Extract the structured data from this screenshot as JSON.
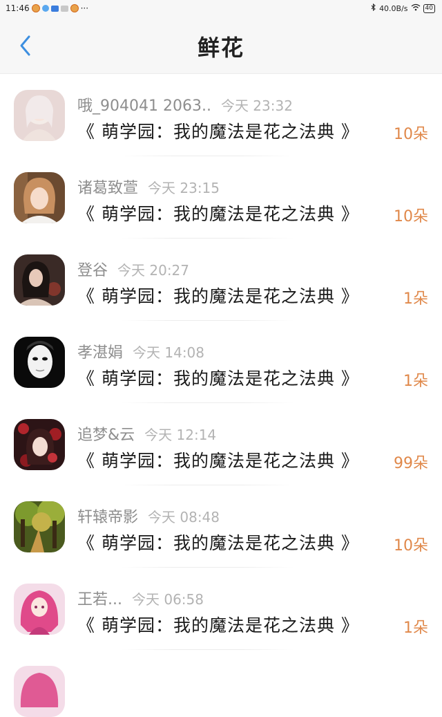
{
  "status_bar": {
    "time": "11:46",
    "more": "···",
    "speed": "40.0B/s",
    "battery": "40"
  },
  "header": {
    "title": "鲜花"
  },
  "gifts": [
    {
      "username": "哦_904041 2063..",
      "time": "今天 23:32",
      "book": "《 萌学园：我的魔法是花之法典 》",
      "amount": "10朵",
      "avatar": "avatar-girl-white-hair"
    },
    {
      "username": "诸葛致萱",
      "time": "今天 23:15",
      "book": "《 萌学园：我的魔法是花之法典 》",
      "amount": "10朵",
      "avatar": "avatar-girl-photo"
    },
    {
      "username": "登谷",
      "time": "今天 20:27",
      "book": "《 萌学园：我的魔法是花之法典 》",
      "amount": "1朵",
      "avatar": "avatar-girl-dark"
    },
    {
      "username": "孝湛娟",
      "time": "今天 14:08",
      "book": "《 萌学园：我的魔法是花之法典 》",
      "amount": "1朵",
      "avatar": "avatar-mask"
    },
    {
      "username": "追梦&云",
      "time": "今天 12:14",
      "book": "《 萌学园：我的魔法是花之法典 》",
      "amount": "99朵",
      "avatar": "avatar-anime-red"
    },
    {
      "username": "轩辕帝影",
      "time": "今天 08:48",
      "book": "《 萌学园：我的魔法是花之法典 》",
      "amount": "10朵",
      "avatar": "avatar-forest"
    },
    {
      "username": "王若...",
      "time": "今天 06:58",
      "book": "《 萌学园：我的魔法是花之法典 》",
      "amount": "1朵",
      "avatar": "avatar-anime-pink"
    }
  ]
}
